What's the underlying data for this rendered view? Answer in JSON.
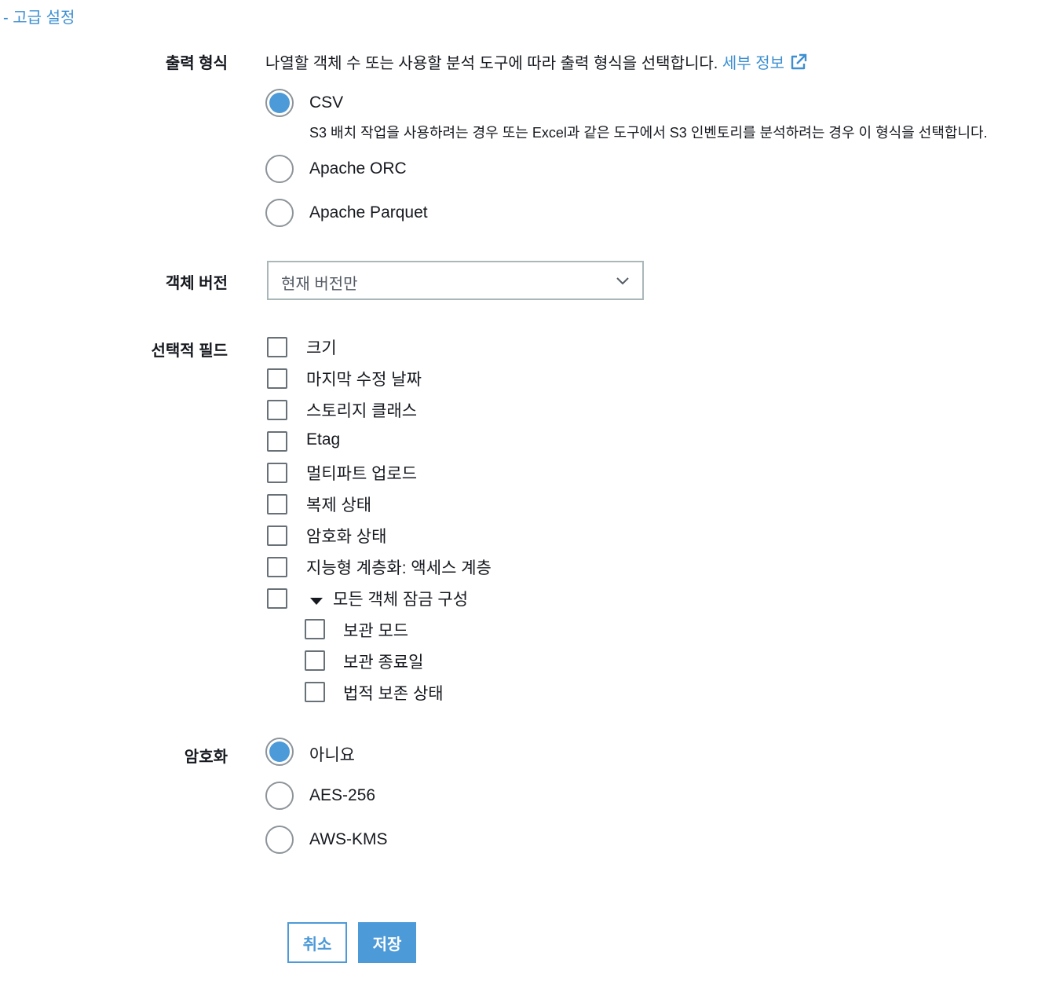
{
  "section": {
    "toggle_label": "- 고급 설정"
  },
  "output_format": {
    "label": "출력 형식",
    "description": "나열할 객체 수 또는 사용할 분석 도구에 따라 출력 형식을 선택합니다.",
    "info_link": "세부 정보",
    "options": [
      {
        "label": "CSV",
        "description": "S3 배치 작업을 사용하려는 경우 또는 Excel과 같은 도구에서 S3 인벤토리를 분석하려는 경우 이 형식을 선택합니다.",
        "selected": true
      },
      {
        "label": "Apache ORC",
        "selected": false
      },
      {
        "label": "Apache Parquet",
        "selected": false
      }
    ]
  },
  "object_version": {
    "label": "객체 버전",
    "selected_value": "현재 버전만"
  },
  "optional_fields": {
    "label": "선택적 필드",
    "items": [
      {
        "label": "크기",
        "checked": false
      },
      {
        "label": "마지막 수정 날짜",
        "checked": false
      },
      {
        "label": "스토리지 클래스",
        "checked": false
      },
      {
        "label": "Etag",
        "checked": false
      },
      {
        "label": "멀티파트 업로드",
        "checked": false
      },
      {
        "label": "복제 상태",
        "checked": false
      },
      {
        "label": "암호화 상태",
        "checked": false
      },
      {
        "label": "지능형 계층화: 액세스 계층",
        "checked": false
      },
      {
        "label": "모든 객체 잠금 구성",
        "checked": false,
        "expanded": true
      }
    ],
    "sub_items": [
      {
        "label": "보관 모드",
        "checked": false
      },
      {
        "label": "보관 종료일",
        "checked": false
      },
      {
        "label": "법적 보존 상태",
        "checked": false
      }
    ]
  },
  "encryption": {
    "label": "암호화",
    "options": [
      {
        "label": "아니요",
        "selected": true
      },
      {
        "label": "AES-256",
        "selected": false
      },
      {
        "label": "AWS-KMS",
        "selected": false
      }
    ]
  },
  "buttons": {
    "cancel": "취소",
    "save": "저장"
  },
  "colors": {
    "accent": "#4d9ad8",
    "link": "#3d8fd1",
    "text": "#16191f"
  }
}
